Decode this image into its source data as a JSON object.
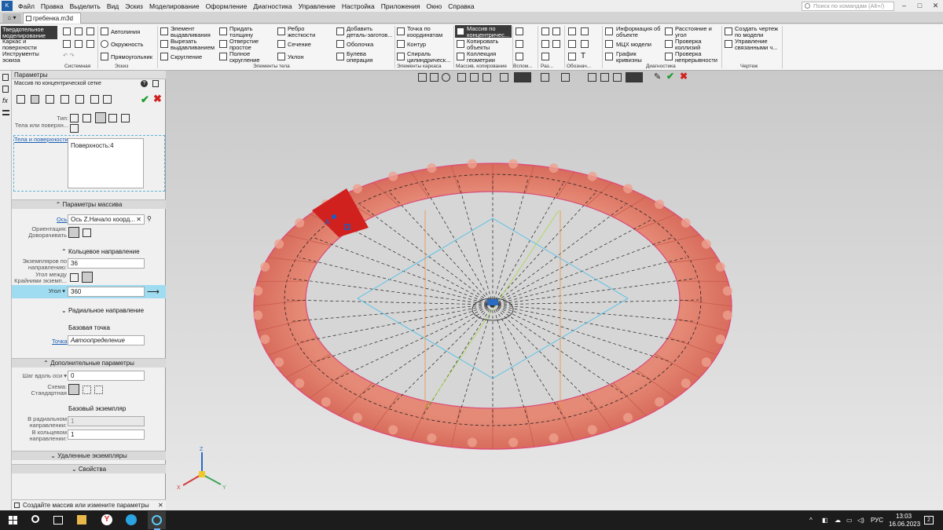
{
  "menu": [
    "Файл",
    "Правка",
    "Выделить",
    "Вид",
    "Эскиз",
    "Моделирование",
    "Оформление",
    "Диагностика",
    "Управление",
    "Настройка",
    "Приложения",
    "Окно",
    "Справка"
  ],
  "search_placeholder": "Поиск по командам (Alt+/)",
  "window_buttons": [
    "–",
    "□",
    "✕"
  ],
  "tab_title": "гребенка.m3d",
  "ribbon": {
    "modes": [
      "Твердотельное моделирование",
      "Каркас и поверхности",
      "Инструменты эскиза"
    ],
    "sketch": [
      "Автолиния",
      "Окружность",
      "Прямоугольник"
    ],
    "body": [
      "Элемент выдавливания",
      "Придать толщину",
      "Ребро жесткости",
      "Добавить деталь-заготов...",
      "Вырезать выдавливанием",
      "Отверстие простое",
      "Сечение",
      "Оболочка",
      "Скругление",
      "Полное скругление",
      "Уклон",
      "Булева операция"
    ],
    "frame": [
      "Точка по координатам",
      "Контур",
      "Спираль цилиндрическ..."
    ],
    "array": [
      "Массив по концентричес...",
      "Копировать объекты",
      "Коллекция геометрии"
    ],
    "diag": [
      "Информация об объекте",
      "Расстояние и угол",
      "МЦХ модели",
      "Проверка коллизий",
      "График кривизны",
      "Проверка непрерывности"
    ],
    "drawing": [
      "Создать чертеж по модели",
      "Управление связанными ч..."
    ],
    "groups": [
      "Системная",
      "Эскиз",
      "Элементы тела",
      "Элементы каркаса",
      "Массив, копирование",
      "Вспом...",
      "Раз...",
      "Обознач...",
      "Диагностика",
      "Чертеж"
    ]
  },
  "panel": {
    "header": "Параметры",
    "subtitle": "Массив по концентрической сетке",
    "type_label": "Тип:",
    "bodies_hint": "Тела или поверхн...",
    "bodies_link": "Тела и поверхности",
    "bodies_value": "Поверхность:4",
    "sec_array": "Параметры массива",
    "axis_link": "Ось",
    "axis_value": "Ось Z.Начало коорд...",
    "orient_label": "Ориентация:",
    "orient_sub": "Доворачивать",
    "sec_ring": "Кольцевое направление",
    "count_label": "Экземпляров по направлению:",
    "count_value": "36",
    "angle_between_label": "Угол между",
    "angle_between_sub": "Крайними экземп...",
    "angle_label": "Угол",
    "angle_value": "360",
    "sec_radial": "Радиальное направление",
    "base_point_title": "Базовая точка",
    "point_link": "Точка",
    "point_value": "Автоопределение",
    "sec_extra": "Дополнительные параметры",
    "step_label": "Шаг вдоль оси",
    "step_value": "0",
    "scheme_label": "Схема:",
    "scheme_sub": "Стандартная",
    "base_inst_title": "Базовый экземпляр",
    "radial_label": "В радиальном направлении:",
    "radial_value": "1",
    "ring_label": "В кольцевом направлении:",
    "ring_value": "1",
    "sec_removed": "Удаленные экземпляры",
    "sec_props": "Свойства"
  },
  "status_text": "Создайте массив или измените параметры",
  "taskbar": {
    "lang": "РУС",
    "time": "13:03",
    "date": "16.06.2023",
    "notif": "2"
  },
  "axes": {
    "x": "X",
    "y": "Y",
    "z": "Z"
  },
  "colors": {
    "accent": "#1f5fa8",
    "ring": "#e8826e",
    "selected": "#d0211f",
    "selected_row": "#9fdcf2"
  }
}
